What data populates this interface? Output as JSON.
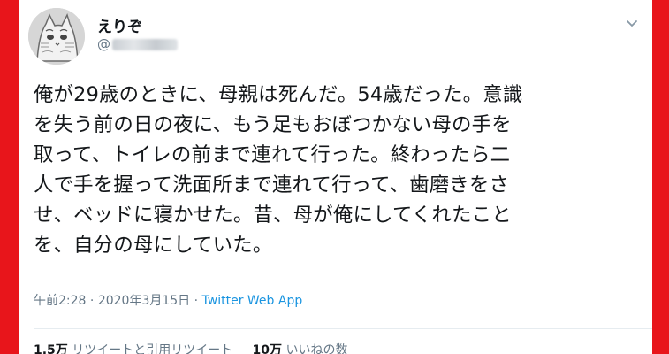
{
  "user": {
    "display_name": "えりぞ",
    "handle_prefix": "@"
  },
  "tweet": {
    "lines": [
      "俺が29歳のときに、母親は死んだ。54歳だった。意識",
      "を失う前の日の夜に、もう足もおぼつかない母の手を",
      "取って、トイレの前まで連れて行った。終わったら二",
      "人で手を握って洗面所まで連れて行って、歯磨きをさ",
      "せ、ベッドに寝かせた。昔、母が俺にしてくれたこと",
      "を、自分の母にしていた。"
    ],
    "time": "午前2:28",
    "separator": "·",
    "date": "2020年3月15日",
    "app": "Twitter Web App"
  },
  "stats": {
    "retweets_count": "1.5万",
    "retweets_label": "リツイートと引用リツイート",
    "likes_count": "10万",
    "likes_label": "いいねの数"
  },
  "colors": {
    "background_border": "#e8151b",
    "link": "#1b95e0",
    "muted": "#657786"
  },
  "icons": {
    "more": "chevron-down-icon"
  }
}
